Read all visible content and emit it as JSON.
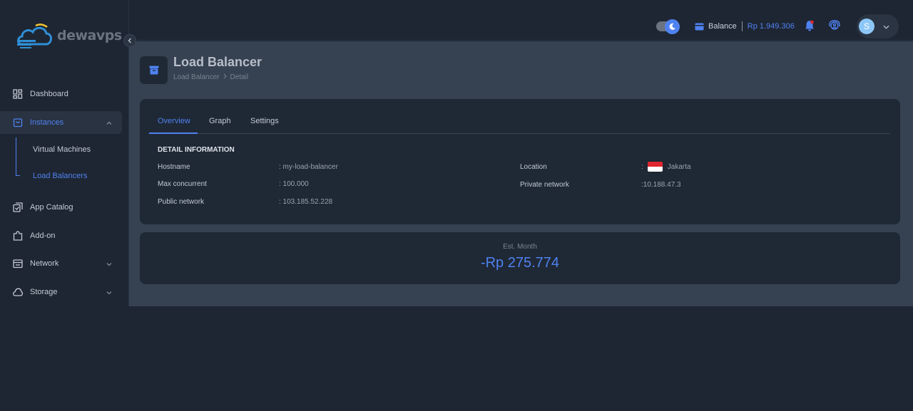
{
  "brand": {
    "name": "dewavps"
  },
  "sidebar": {
    "items": [
      {
        "label": "Dashboard",
        "icon": "dashboard-icon"
      },
      {
        "label": "Instances",
        "icon": "instances-icon",
        "expanded": true,
        "children": [
          {
            "label": "Virtual Machines"
          },
          {
            "label": "Load Balancers",
            "active": true
          }
        ]
      },
      {
        "label": "App Catalog",
        "icon": "app-catalog-icon"
      },
      {
        "label": "Add-on",
        "icon": "puzzle-icon"
      },
      {
        "label": "Network",
        "icon": "network-icon"
      },
      {
        "label": "Storage",
        "icon": "cloud-icon"
      }
    ]
  },
  "header": {
    "balance_label": "Balance",
    "balance_value": "Rp 1.949.306",
    "user_initial": "S"
  },
  "page": {
    "title": "Load Balancer",
    "breadcrumb": [
      "Load Balancer",
      "Detail"
    ]
  },
  "tabs": [
    "Overview",
    "Graph",
    "Settings"
  ],
  "detail": {
    "section_title": "DETAIL INFORMATION",
    "left": [
      {
        "label": "Hostname",
        "value": ": my-load-balancer"
      },
      {
        "label": "Max concurrent",
        "value": ": 100.000"
      },
      {
        "label": "Public network",
        "value": ": 103.185.52.228"
      }
    ],
    "right": [
      {
        "label": "Location",
        "prefix": ":",
        "value": "Jakarta"
      },
      {
        "label": "Private network",
        "value": ":10.188.47.3"
      }
    ]
  },
  "cost": {
    "label": "Est. Month",
    "value": "-Rp 275.774"
  },
  "colors": {
    "accent": "#4f82f1",
    "background": "#1e2633",
    "panel": "#1f2835",
    "main": "#364251"
  }
}
